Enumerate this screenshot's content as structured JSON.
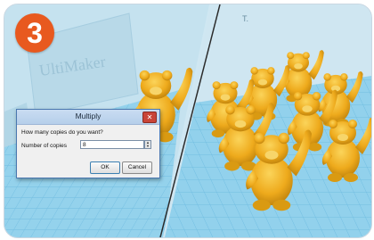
{
  "step_badge": "3",
  "brand_watermark": "UltiMaker",
  "dialog": {
    "title": "Multiply",
    "close_glyph": "✕",
    "question": "How many copies do you want?",
    "copies_label": "Number of copies",
    "copies_value": "8",
    "spin_up_glyph": "▲",
    "spin_down_glyph": "▼",
    "ok_label": "OK",
    "cancel_label": "Cancel"
  },
  "colors": {
    "badge": "#e8591f",
    "bear": "#f2c21f",
    "build_plate": "#8ed0ec"
  },
  "icons": {
    "close": "close-icon",
    "spin_up": "spin-up-icon",
    "spin_down": "spin-down-icon"
  }
}
